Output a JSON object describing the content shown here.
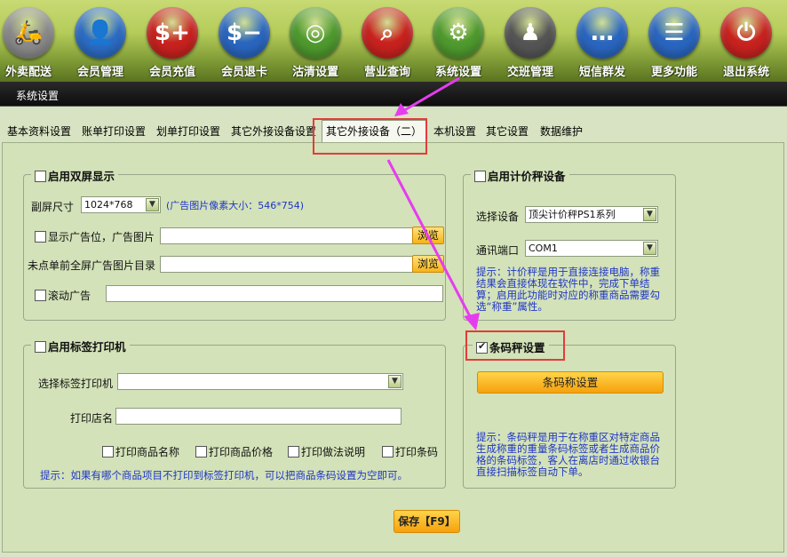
{
  "toolbar": {
    "items": [
      {
        "label": "外卖配送",
        "icon": "scooter-icon",
        "glyph": "🛵",
        "color": "#8a8a8a"
      },
      {
        "label": "会员管理",
        "icon": "user-icon",
        "glyph": "👤",
        "color": "#2c6cc4"
      },
      {
        "label": "会员充值",
        "icon": "card-plus-icon",
        "glyph": "$+",
        "color": "#c9221f"
      },
      {
        "label": "会员退卡",
        "icon": "card-minus-icon",
        "glyph": "$−",
        "color": "#2a66c0"
      },
      {
        "label": "沽清设置",
        "icon": "plate-icon",
        "glyph": "◎",
        "color": "#4f9a2e"
      },
      {
        "label": "营业查询",
        "icon": "magnifier-icon",
        "glyph": "⌕",
        "color": "#c9221f"
      },
      {
        "label": "系统设置",
        "icon": "gear-icon",
        "glyph": "⚙",
        "color": "#4f9a2e"
      },
      {
        "label": "交班管理",
        "icon": "meeting-icon",
        "glyph": "♟",
        "color": "#555555"
      },
      {
        "label": "短信群发",
        "icon": "chat-icon",
        "glyph": "…",
        "color": "#2a66c0"
      },
      {
        "label": "更多功能",
        "icon": "list-icon",
        "glyph": "☰",
        "color": "#2a66c0"
      },
      {
        "label": "退出系统",
        "icon": "power-icon",
        "glyph": "⏻",
        "color": "#c9221f"
      }
    ]
  },
  "titlebar": {
    "title": "系统设置"
  },
  "tabs": [
    {
      "label": "基本资料设置"
    },
    {
      "label": "账单打印设置"
    },
    {
      "label": "划单打印设置"
    },
    {
      "label": "其它外接设备设置"
    },
    {
      "label": "其它外接设备（二）",
      "active": true
    },
    {
      "label": "本机设置"
    },
    {
      "label": "其它设置"
    },
    {
      "label": "数据维护"
    }
  ],
  "dual_screen": {
    "legend": "启用双屏显示",
    "size_label": "副屏尺寸",
    "size_value": "1024*768",
    "size_hint": "(广告图片像素大小：546*754)",
    "ad_label": "显示广告位，广告图片",
    "ad_value": "",
    "fullscreen_label": "未点单前全屏广告图片目录",
    "fullscreen_value": "",
    "browse_label": "浏览",
    "scroll_label": "滚动广告",
    "scroll_value": ""
  },
  "scale_device": {
    "legend": "启用计价秤设备",
    "device_label": "选择设备",
    "device_value": "顶尖计价秤PS1系列",
    "port_label": "通讯端口",
    "port_value": "COM1",
    "hint": "提示：计价秤是用于直接连接电脑，称重结果会直接体现在软件中，完成下单结算；启用此功能时对应的称重商品需要勾选“称重”属性。"
  },
  "label_printer": {
    "legend": "启用标签打印机",
    "printer_label": "选择标签打印机",
    "printer_value": "",
    "shop_label": "打印店名",
    "shop_value": "",
    "options": [
      "打印商品名称",
      "打印商品价格",
      "打印做法说明",
      "打印条码"
    ],
    "hint": "提示：如果有哪个商品项目不打印到标签打印机，可以把商品条码设置为空即可。"
  },
  "barcode_scale": {
    "legend": "条码秤设置",
    "checked": true,
    "button": "条码称设置",
    "hint": "提示：条码秤是用于在称重区对特定商品生成称重的重量条码标签或者生成商品价格的条码标签，客人在离店时通过收银台直接扫描标签自动下单。"
  },
  "save_button": "保存【F9】",
  "annotation_color": "#e63cf0"
}
